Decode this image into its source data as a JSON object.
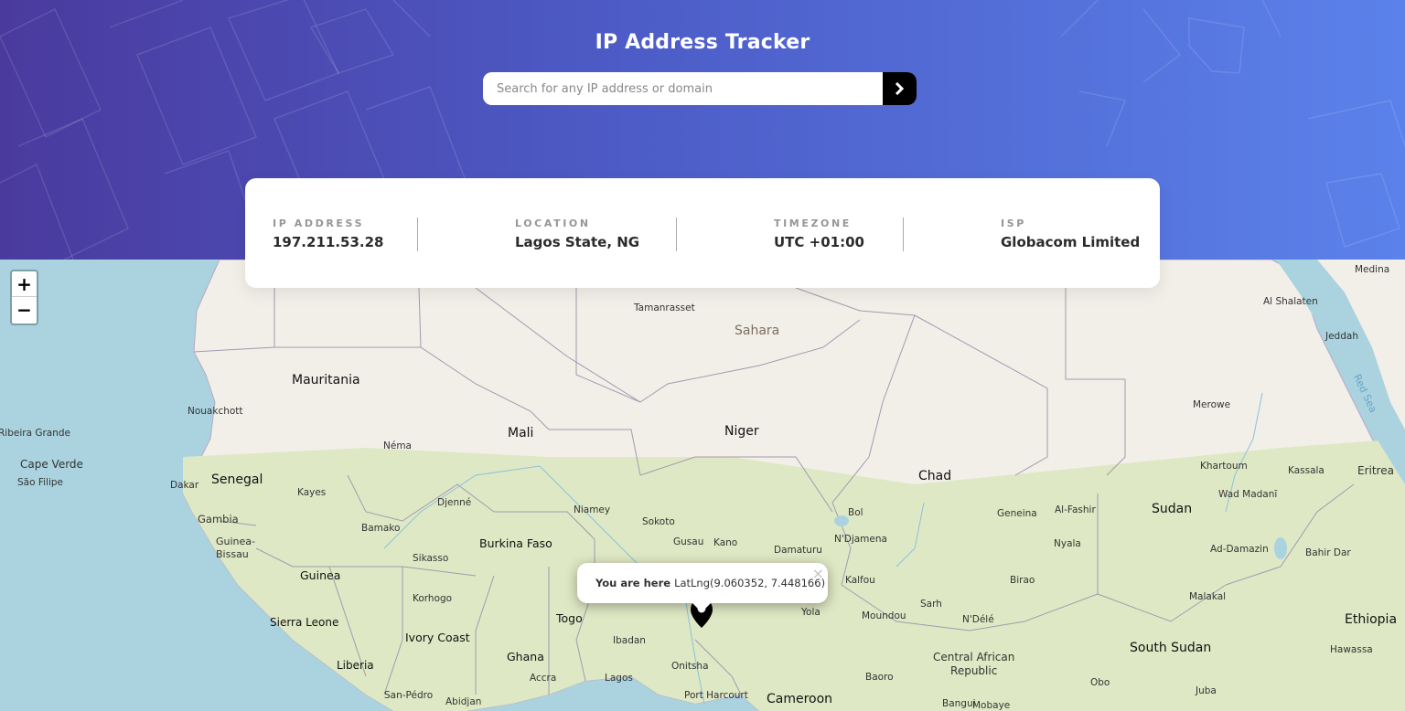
{
  "header": {
    "title": "IP Address Tracker",
    "search_placeholder": "Search for any IP address or domain",
    "search_value": ""
  },
  "info": {
    "ip": {
      "label": "IP Address",
      "value": "197.211.53.28"
    },
    "location": {
      "label": "Location",
      "value": "Lagos State, NG"
    },
    "timezone": {
      "label": "Timezone",
      "value": "UTC +01:00"
    },
    "isp": {
      "label": "ISP",
      "value": "Globacom Limited"
    }
  },
  "map": {
    "zoom_in": "+",
    "zoom_out": "−",
    "popup": {
      "bold": "You are here",
      "text": "LatLng(9.060352, 7.448166)",
      "close": "×"
    },
    "labels": {
      "tamanrasset": "Tamanrasset",
      "sahara": "Sahara",
      "mauritania": "Mauritania",
      "nouakchott": "Nouakchott",
      "mali": "Mali",
      "niger": "Niger",
      "chad": "Chad",
      "sudan": "Sudan",
      "south_sudan": "South Sudan",
      "ethiopia": "Ethiopia",
      "eritrea": "Eritrea",
      "senegal": "Senegal",
      "dakar": "Dakar",
      "gambia": "Gambia",
      "guinea_bissau": "Guinea-\nBissau",
      "guinea": "Guinea",
      "sierra_leone": "Sierra Leone",
      "liberia": "Liberia",
      "ivory_coast": "Ivory Coast",
      "ghana": "Ghana",
      "togo": "Togo",
      "burkina_faso": "Burkina Faso",
      "cape_verde": "Cape Verde",
      "ribeira_grande": "Ribeira Grande",
      "sao_filipe": "São Filipe",
      "nema": "Néma",
      "kayes": "Kayes",
      "djenne": "Djenné",
      "bamako": "Bamako",
      "sikasso": "Sikasso",
      "korhogo": "Korhogo",
      "niamey": "Niamey",
      "sokoto": "Sokoto",
      "gusau": "Gusau",
      "kano": "Kano",
      "damaturu": "Damaturu",
      "ndjamena": "N'Djamena",
      "bol": "Bol",
      "kalfou": "Kalfou",
      "moundou": "Moundou",
      "sarh": "Sarh",
      "ndele": "N'Délé",
      "birao": "Birao",
      "geneina": "Geneina",
      "al_fashir": "Al-Fashir",
      "nyala": "Nyala",
      "khartoum": "Khartoum",
      "kassala": "Kassala",
      "wad_madani": "Wad Madanī",
      "ad_damazin": "Ad-Damazin",
      "bahir_dar": "Bahir Dar",
      "malakal": "Malakal",
      "hawassa": "Hawassa",
      "merowe": "Merowe",
      "jeddah": "Jeddah",
      "al_shalaten": "Al Shalaten",
      "medina": "Medina",
      "red_sea": "Red Sea",
      "ibadan": "Ibadan",
      "lagos": "Lagos",
      "onitsha": "Onitsha",
      "port_harcourt": "Port Harcourt",
      "accra": "Accra",
      "san_pedro": "San-Pédro",
      "abidjan": "Abidjan",
      "cameroon": "Cameroon",
      "central_african_republic": "Central African\nRepublic",
      "yola": "Yola",
      "baoro": "Baoro",
      "bangui": "Bangui",
      "mobaye": "Mobaye",
      "obo": "Obo",
      "juba": "Juba"
    }
  },
  "colors": {
    "header_start": "#4a3a9e",
    "header_end": "#5b82ea",
    "water": "#aad3df",
    "land_desert": "#f2efe9",
    "land_green": "#dfe8c4"
  },
  "icons": {
    "search_button": "chevron-right-icon",
    "marker": "location-pin-icon"
  }
}
